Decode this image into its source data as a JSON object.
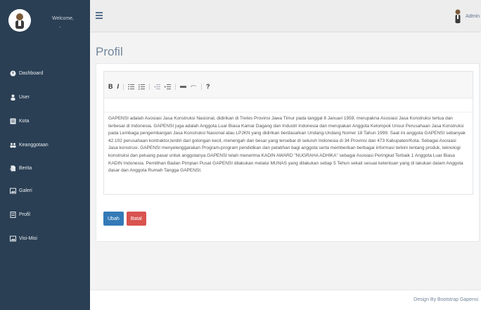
{
  "sidebar": {
    "welcome": "Welcome,",
    "user_name": "-",
    "items": [
      {
        "label": "Dashboard",
        "icon": "dashboard-icon"
      },
      {
        "label": "User",
        "icon": "user-icon"
      },
      {
        "label": "Kota",
        "icon": "list-icon"
      },
      {
        "label": "Keanggotaan",
        "icon": "members-icon"
      },
      {
        "label": "Berita",
        "icon": "file-icon"
      },
      {
        "label": "Galeri",
        "icon": "image-icon"
      },
      {
        "label": "Profil",
        "icon": "profile-icon"
      },
      {
        "label": "Visi-Misi",
        "icon": "image-icon"
      }
    ]
  },
  "header": {
    "admin_label": "Admin"
  },
  "main": {
    "title": "Profil",
    "toolbar": {
      "bold": "B",
      "italic": "I",
      "help": "?"
    },
    "content": "GAPENSI adalah Asosiasi Jasa Konstruksi Nasional, didirikan di Tretes Provinsi Jawa Timur pada tanggal 8 Januari 1959, merupakna Asosiasi Jasa Konstruksi tertua dan terbesar di Indonesia. GAPENSI juga adalah Anggota Luar Biasa Kamar Dagang dan Industri Indonesia dan merupakan Anggota Kelompok Unsur Perusahaan Jasa Konstruksi pada Lembaga pengembangan Jasa Konstruksi Nasional atau LPJKN yang didirikan berdasarkan Undang-Undang Nomer 18 Tahun 1999. Saat ini anggota GAPENSI sebanyak 42.102 perusahaan kontraktor,terdiri dari golongan kecil, menengah dan besar yang tersebar di seluruh Indonesia di 34 Provinsi dan 473 Kabupaten/Kota. Sebagai Asosiasi Jasa konstrusi. GAPENSI menyelenggarakan Program-program pendidikan dan pelatihan bagi anggota serta memberikan berbagai informasi terkini tentang produk, teknologi konstruksi dan peluang pasar untuk anggotanya.GAPENSI telah menerima KADIN AWARD \"NUGRAHA ADHIKA\" sebagai Asosiasi Peringkat Terbaik 1 Anggota Luar Biasa KADIN Indonesia. Pemilihan Badan Pimpian Pusat GAPENSI dilakukan melalui MUNAS yang dilakukan setiap 5 Tehun sekali sesuai ketentuan yang di lakukan dalam Anggota dasar dan Anggota Rumah Tangga GAPENSI.",
    "buttons": {
      "save": "Ubah",
      "cancel": "Batal"
    }
  },
  "footer": {
    "text": "Design By Bootstrap Gapensi"
  },
  "colors": {
    "sidebar_bg": "#2a3f54",
    "primary": "#337ab7",
    "danger": "#d9534f"
  }
}
